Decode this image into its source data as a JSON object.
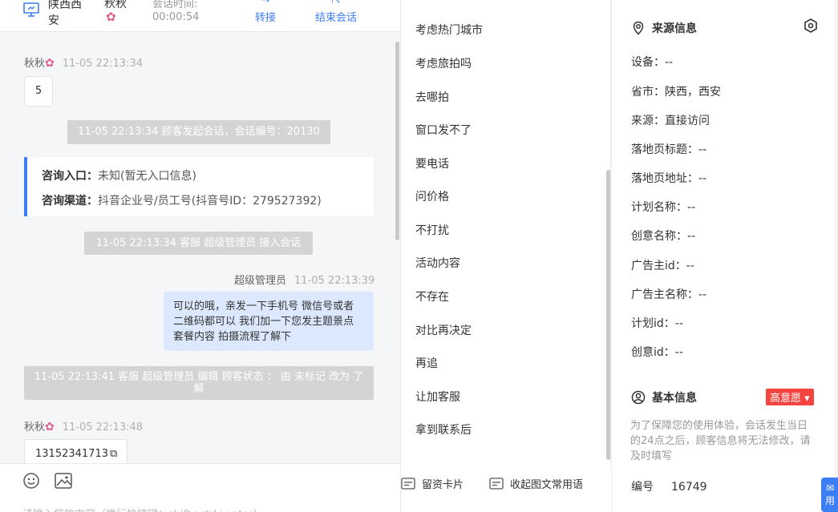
{
  "session": {
    "location": "陕西西安",
    "customer_name": "秋秋",
    "duration_label": "会话时间:",
    "duration": "00:00:54",
    "transfer_label": "转接",
    "end_label": "结束会话"
  },
  "messages": {
    "m1_sender": "秋秋",
    "m1_time": "11-05 22:13:34",
    "m1_text": "5",
    "sys1": "11-05 22:13:34 顾客发起会话，会话编号：20130",
    "entry_label": "咨询入口：",
    "entry_value": "未知(暂无入口信息)",
    "channel_label": "咨询渠道：",
    "channel_value": "抖音企业号/员工号(抖音号ID：279527392)",
    "sys2": "11-05 22:13:34 客服 超级管理员 接入会话",
    "m2_sender": "超级管理员",
    "m2_time": "11-05 22:13:39",
    "m2_text": "可以的哦，亲发一下手机号 微信号或者二维码都可以 我们加一下您发主题景点 套餐内容 拍摄流程了解下",
    "sys3": "11-05 22:13:41 客服 超级管理员 编辑 顾客状态 ： 由 未标记 改为 了解",
    "m3_sender": "秋秋",
    "m3_time": "11-05 22:13:48",
    "m3_text": "13152341713",
    "input_placeholder": "请输入您的内容（换行快捷键：shift+ctrl+enter）"
  },
  "phrases": [
    "考虑热门城市",
    "考虑旅拍吗",
    "去哪拍",
    "窗口发不了",
    "要电话",
    "问价格",
    "不打扰",
    "活动内容",
    "不存在",
    "对比再决定",
    "再追",
    "让加客服",
    "拿到联系后"
  ],
  "phrase_tools": {
    "card": "留资卡片",
    "collapse": "收起图文常用语"
  },
  "source": {
    "title": "来源信息",
    "rows": [
      "设备：--",
      "省市：陕西，西安",
      "来源：直接访问",
      "落地页标题：--",
      "落地页地址：--",
      "计划名称：--",
      "创意名称：--",
      "广告主id：--",
      "广告主名称：--",
      "计划id：--",
      "创意id：--"
    ]
  },
  "basic": {
    "title": "基本信息",
    "intent_tag": "高意愿",
    "note": "为了保障您的使用体验，会话发生当日的24点之后，顾客信息将无法修改，请及时填写",
    "id_label": "编号",
    "id_value": "16749"
  },
  "float_label": "用"
}
